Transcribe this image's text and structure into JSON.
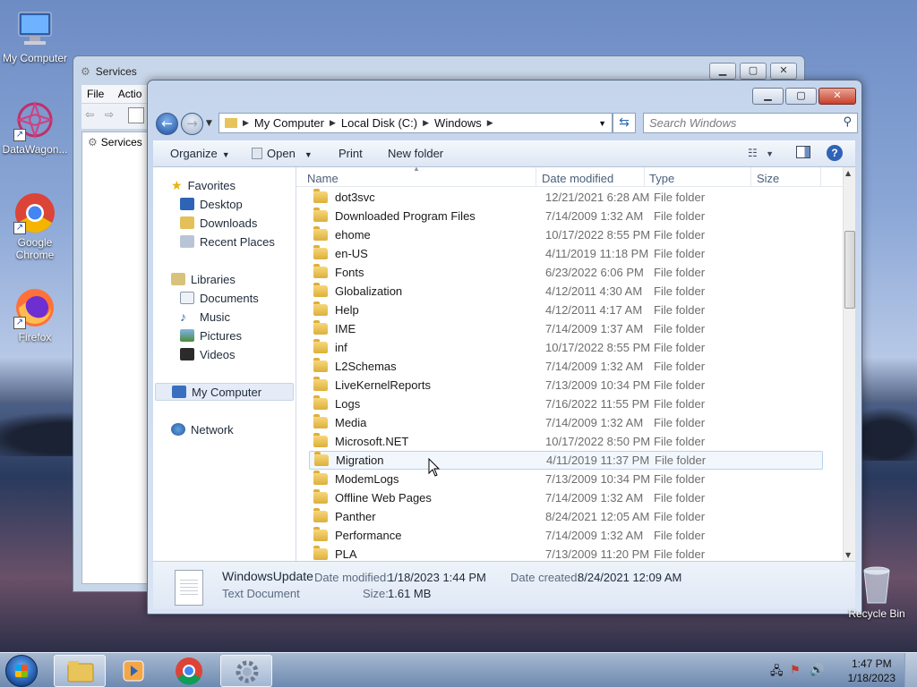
{
  "desktop": {
    "icons": [
      {
        "label": "My Computer"
      },
      {
        "label": "DataWagon..."
      },
      {
        "label": "Google Chrome"
      },
      {
        "label": "Firefox"
      },
      {
        "label": "Recycle Bin"
      }
    ]
  },
  "services_window": {
    "title": "Services",
    "menu": [
      "File",
      "Actio"
    ],
    "tree_item": "Services"
  },
  "explorer": {
    "breadcrumb": [
      "My Computer",
      "Local Disk (C:)",
      "Windows"
    ],
    "search_placeholder": "Search Windows",
    "commands": {
      "organize": "Organize",
      "open": "Open",
      "print": "Print",
      "new_folder": "New folder"
    },
    "nav": {
      "favorites": "Favorites",
      "desktop": "Desktop",
      "downloads": "Downloads",
      "recent": "Recent Places",
      "libraries": "Libraries",
      "documents": "Documents",
      "music": "Music",
      "pictures": "Pictures",
      "videos": "Videos",
      "my_computer": "My Computer",
      "network": "Network"
    },
    "columns": {
      "name": "Name",
      "date": "Date modified",
      "type": "Type",
      "size": "Size"
    },
    "files": [
      {
        "name": "dot3svc",
        "date": "12/21/2021 6:28 AM",
        "type": "File folder"
      },
      {
        "name": "Downloaded Program Files",
        "date": "7/14/2009 1:32 AM",
        "type": "File folder"
      },
      {
        "name": "ehome",
        "date": "10/17/2022 8:55 PM",
        "type": "File folder"
      },
      {
        "name": "en-US",
        "date": "4/11/2019 11:18 PM",
        "type": "File folder"
      },
      {
        "name": "Fonts",
        "date": "6/23/2022 6:06 PM",
        "type": "File folder"
      },
      {
        "name": "Globalization",
        "date": "4/12/2011 4:30 AM",
        "type": "File folder"
      },
      {
        "name": "Help",
        "date": "4/12/2011 4:17 AM",
        "type": "File folder"
      },
      {
        "name": "IME",
        "date": "7/14/2009 1:37 AM",
        "type": "File folder"
      },
      {
        "name": "inf",
        "date": "10/17/2022 8:55 PM",
        "type": "File folder"
      },
      {
        "name": "L2Schemas",
        "date": "7/14/2009 1:32 AM",
        "type": "File folder"
      },
      {
        "name": "LiveKernelReports",
        "date": "7/13/2009 10:34 PM",
        "type": "File folder"
      },
      {
        "name": "Logs",
        "date": "7/16/2022 11:55 PM",
        "type": "File folder"
      },
      {
        "name": "Media",
        "date": "7/14/2009 1:32 AM",
        "type": "File folder"
      },
      {
        "name": "Microsoft.NET",
        "date": "10/17/2022 8:50 PM",
        "type": "File folder"
      },
      {
        "name": "Migration",
        "date": "4/11/2019 11:37 PM",
        "type": "File folder"
      },
      {
        "name": "ModemLogs",
        "date": "7/13/2009 10:34 PM",
        "type": "File folder"
      },
      {
        "name": "Offline Web Pages",
        "date": "7/14/2009 1:32 AM",
        "type": "File folder"
      },
      {
        "name": "Panther",
        "date": "8/24/2021 12:05 AM",
        "type": "File folder"
      },
      {
        "name": "Performance",
        "date": "7/14/2009 1:32 AM",
        "type": "File folder"
      },
      {
        "name": "PLA",
        "date": "7/13/2009 11:20 PM",
        "type": "File folder"
      }
    ],
    "details": {
      "name": "WindowsUpdate",
      "kind": "Text Document",
      "modified_label": "Date modified:",
      "modified": "1/18/2023 1:44 PM",
      "created_label": "Date created:",
      "created": "8/24/2021 12:09 AM",
      "size_label": "Size:",
      "size": "1.61 MB"
    }
  },
  "taskbar": {
    "time": "1:47 PM",
    "date": "1/18/2023"
  }
}
